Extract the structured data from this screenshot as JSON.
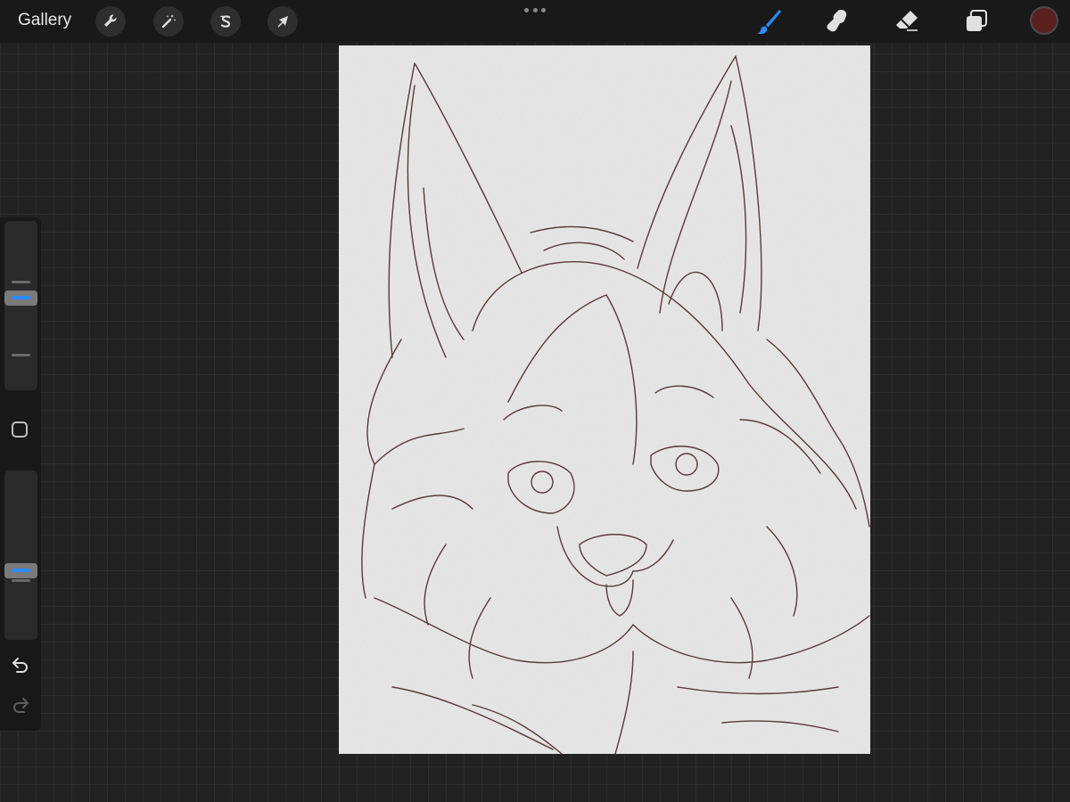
{
  "topbar": {
    "gallery_label": "Gallery",
    "left_tools": [
      {
        "name": "actions",
        "icon": "wrench-icon"
      },
      {
        "name": "adjustments",
        "icon": "magic-wand-icon"
      },
      {
        "name": "selection",
        "icon": "selection-s-icon"
      },
      {
        "name": "transform",
        "icon": "arrow-cursor-icon"
      }
    ],
    "more_menu_icon": "more-dots-icon",
    "right_tools": [
      {
        "name": "brush",
        "icon": "brush-icon",
        "active": true
      },
      {
        "name": "smudge",
        "icon": "smudge-finger-icon",
        "active": false
      },
      {
        "name": "eraser",
        "icon": "eraser-icon",
        "active": false
      },
      {
        "name": "layers",
        "icon": "layers-icon",
        "active": false
      }
    ],
    "current_color": "#5a1f1f"
  },
  "sidebar": {
    "brush_size_level": 0.55,
    "opacity_level": 0.4,
    "modify_icon": "square-modify-icon",
    "undo_icon": "undo-icon",
    "redo_icon": "redo-icon"
  },
  "canvas": {
    "artwork": "fox-sketch",
    "paper_color": "#e9e9e9",
    "line_color": "#5a3a3a"
  },
  "colors": {
    "accent": "#2a8cff",
    "toolbar_bg": "#191919",
    "workspace_bg": "#222222"
  }
}
